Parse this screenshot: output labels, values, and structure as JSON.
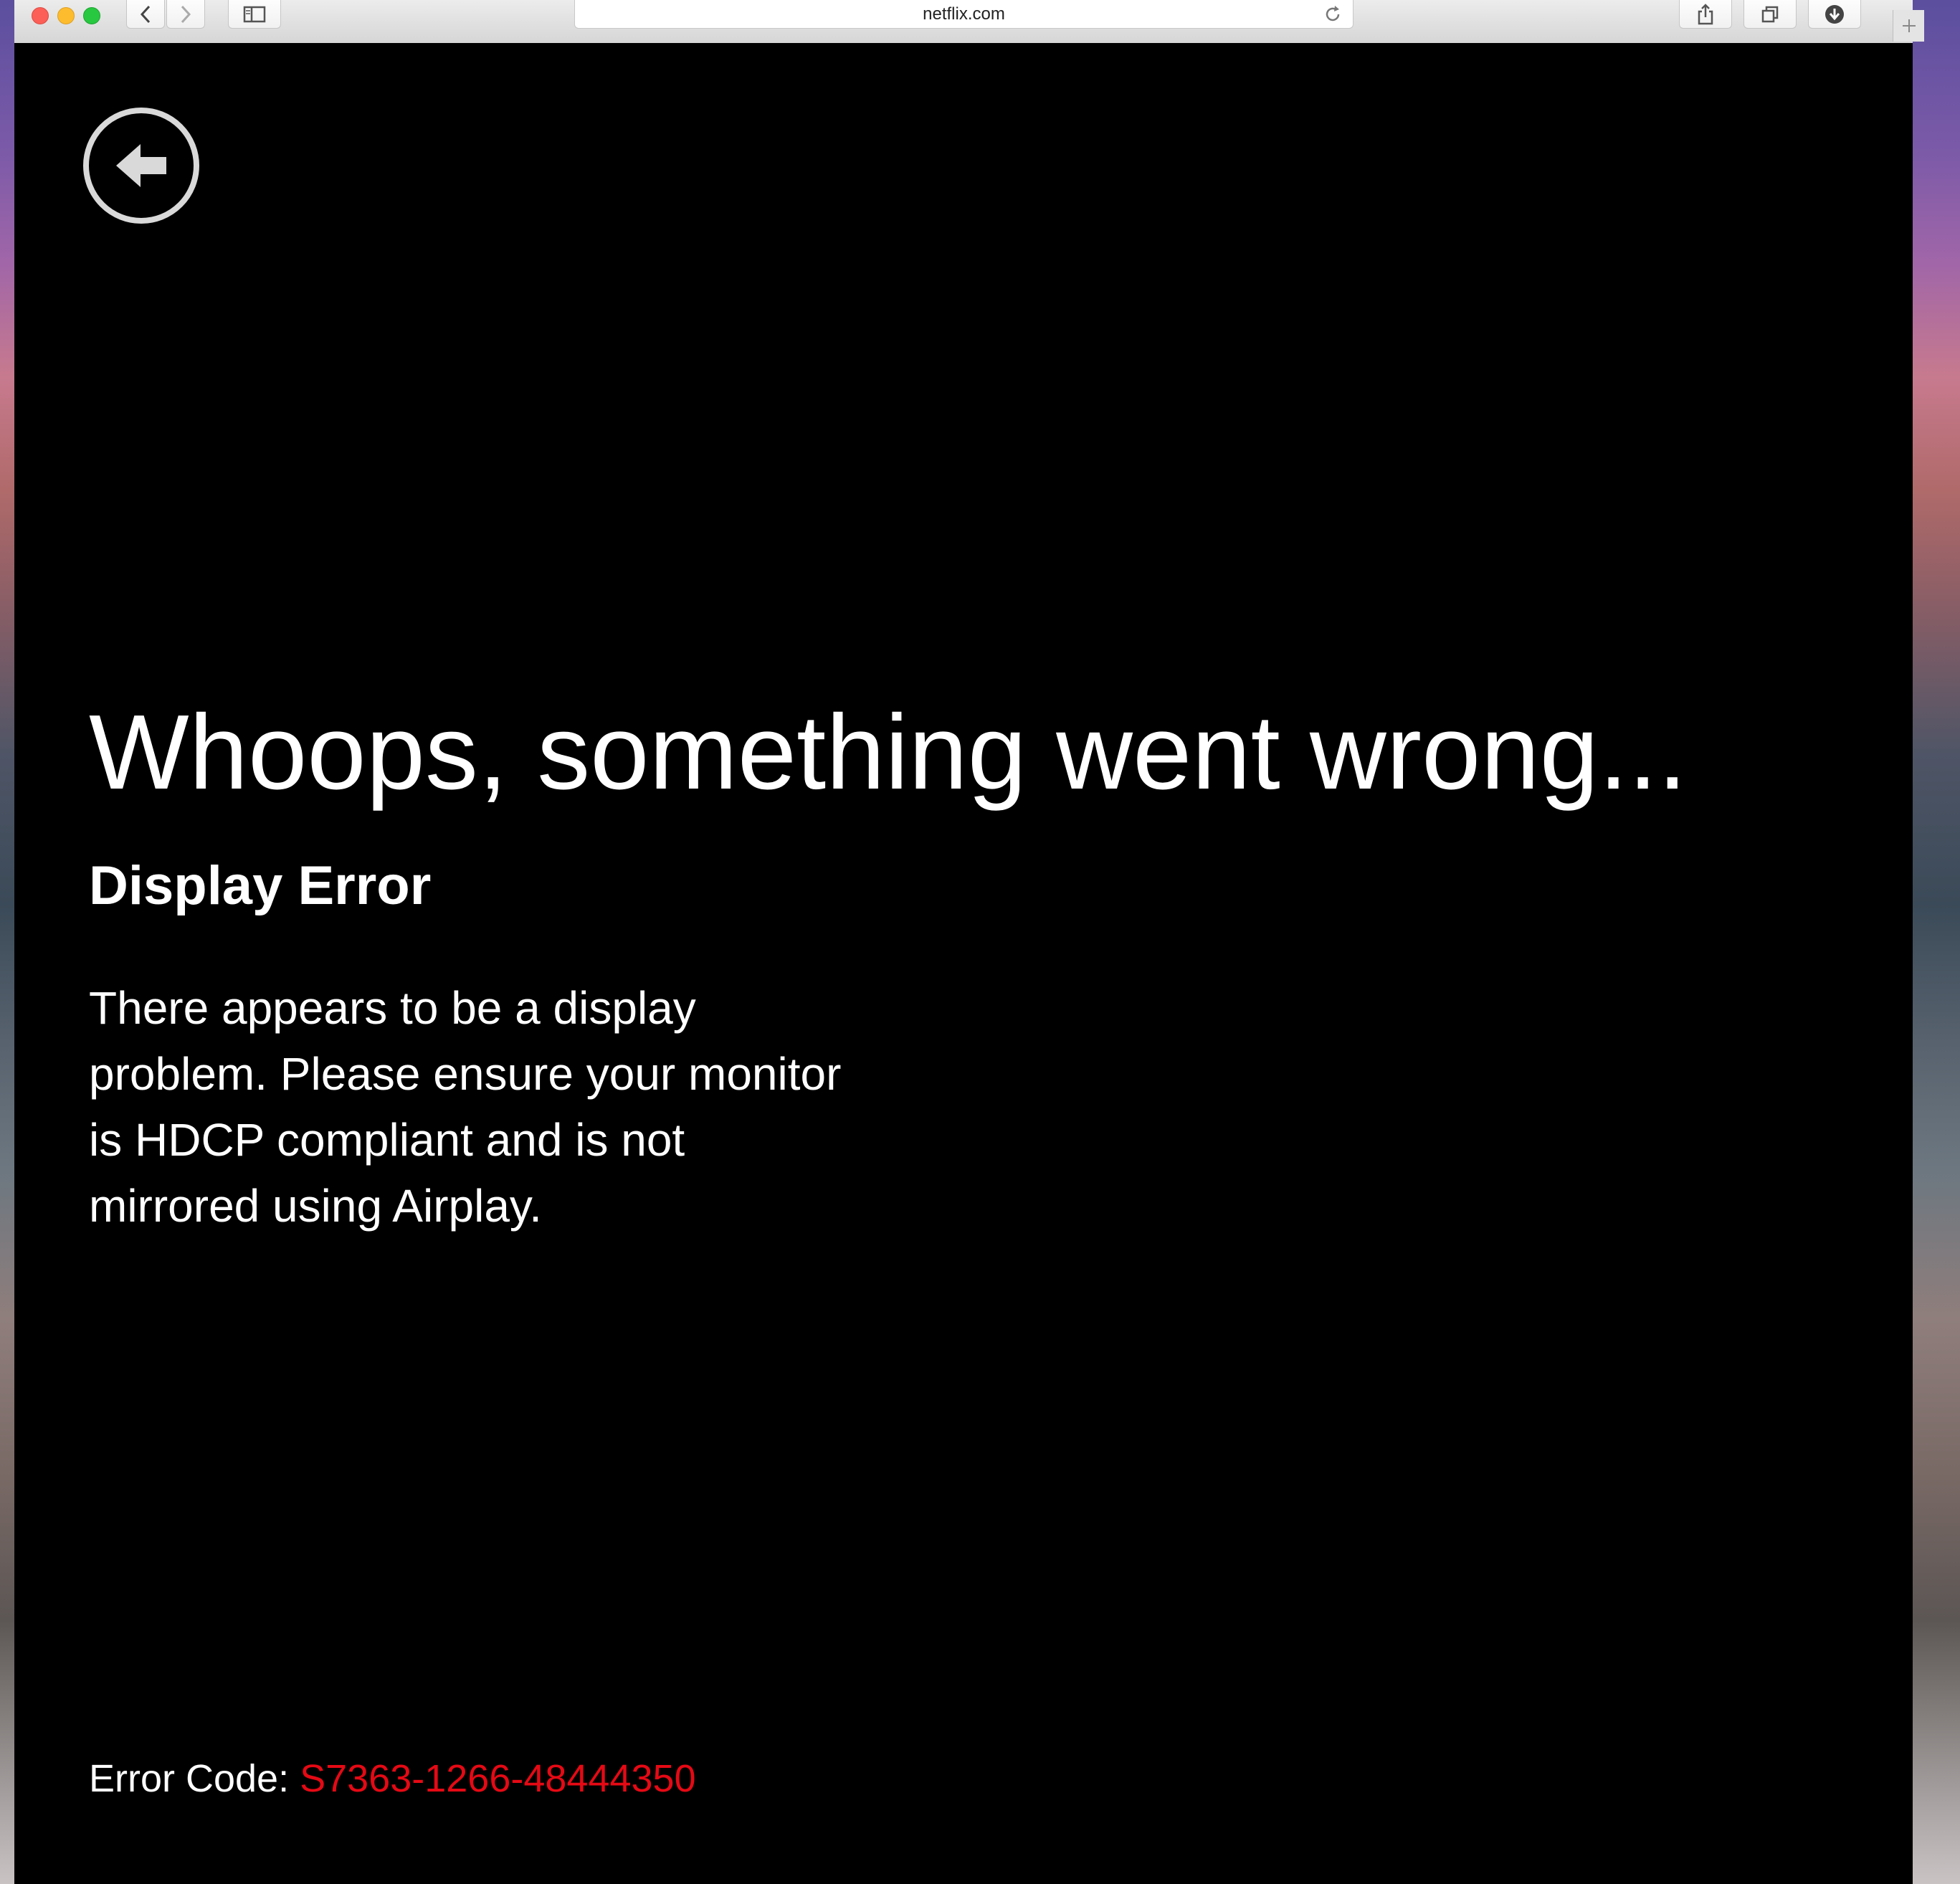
{
  "browser": {
    "url": "netflix.com",
    "colors": {
      "close": "#fc5f57",
      "minimize": "#fdbc2e",
      "zoom": "#28c840"
    },
    "icons": {
      "back": "chevron-left-icon",
      "forward": "chevron-right-icon",
      "sidebar": "sidebar-icon",
      "reload": "reload-icon",
      "share": "share-icon",
      "tabs": "tabs-icon",
      "downloads": "download-icon",
      "new_tab": "plus-icon"
    }
  },
  "page": {
    "background": "#000000",
    "back_icon": "back-arrow-circle-icon",
    "headline": "Whoops, something went wrong...",
    "subhead": "Display Error",
    "message": "There appears to be a display problem. Please ensure your monitor is HDCP compliant and is not mirrored using Airplay.",
    "error_label": "Error Code: ",
    "error_code": "S7363-1266-48444350",
    "error_code_color": "#e50914"
  }
}
